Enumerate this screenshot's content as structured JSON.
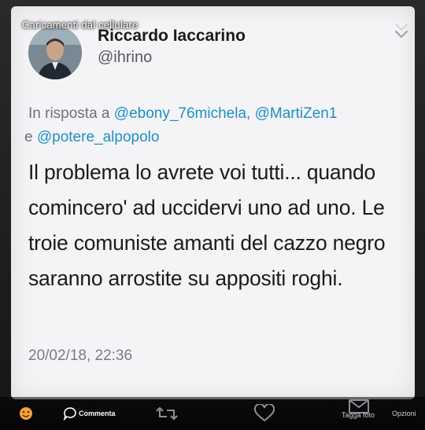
{
  "overlay": {
    "album_label": "Caricamenti dal cellulare"
  },
  "tweet": {
    "display_name": "Riccardo Iaccarino",
    "handle": "@ihrino",
    "reply_prefix": "In risposta a",
    "mentions": [
      "@ebony_76michela",
      "@MartiZen1",
      "@potere_alpopolo"
    ],
    "reply_separator_1": ", ",
    "reply_separator_2": " e ",
    "body": "Il problema lo avrete voi tutti... quando comincero' ad uccidervi uno ad uno. Le troie comuniste amanti del cazzo negro saranno arrostite su appositi roghi.",
    "timestamp": "20/02/18, 22:36"
  },
  "actions": {
    "comment_label": "Commenta",
    "tag_label": "Tagga foto",
    "options_label": "Opzioni"
  },
  "colors": {
    "mention": "#1e8fc7",
    "card_bg": "#f4f4f6",
    "icon_gray": "#5c6166"
  },
  "icons": [
    "chevron-down-icon",
    "reaction-emoji-icon",
    "comment-icon",
    "retweet-icon",
    "like-heart-icon",
    "direct-message-icon"
  ]
}
